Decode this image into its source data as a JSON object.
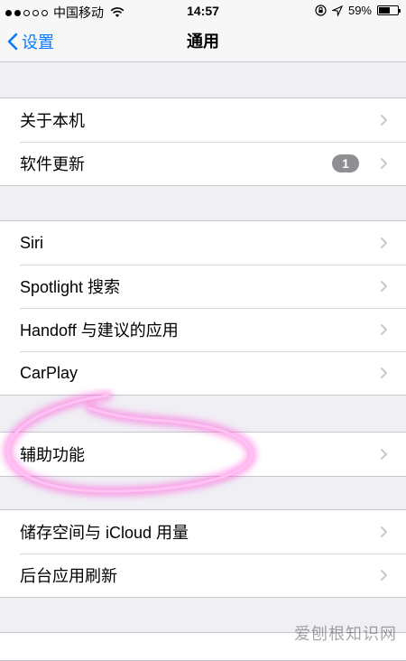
{
  "status": {
    "carrier": "中国移动",
    "time": "14:57",
    "battery_percent": "59%",
    "battery_level": 0.59,
    "icons": [
      "signal-dots-icon",
      "wifi-icon",
      "orientation-lock-icon",
      "location-arrow-icon",
      "battery-icon"
    ]
  },
  "nav": {
    "back_label": "设置",
    "title": "通用"
  },
  "groups": [
    {
      "items": [
        {
          "label": "关于本机"
        },
        {
          "label": "软件更新",
          "badge": "1"
        }
      ]
    },
    {
      "items": [
        {
          "label": "Siri"
        },
        {
          "label": "Spotlight 搜索"
        },
        {
          "label": "Handoff 与建议的应用"
        },
        {
          "label": "CarPlay"
        }
      ]
    },
    {
      "items": [
        {
          "label": "辅助功能"
        }
      ]
    },
    {
      "items": [
        {
          "label": "储存空间与 iCloud 用量"
        },
        {
          "label": "后台应用刷新"
        }
      ]
    }
  ],
  "annotation": {
    "color": "#ff4fd8"
  },
  "watermark": "爱刨根知识网",
  "colors": {
    "accent": "#0a7aff",
    "background": "#efeff4",
    "badge": "#8e8e93"
  }
}
